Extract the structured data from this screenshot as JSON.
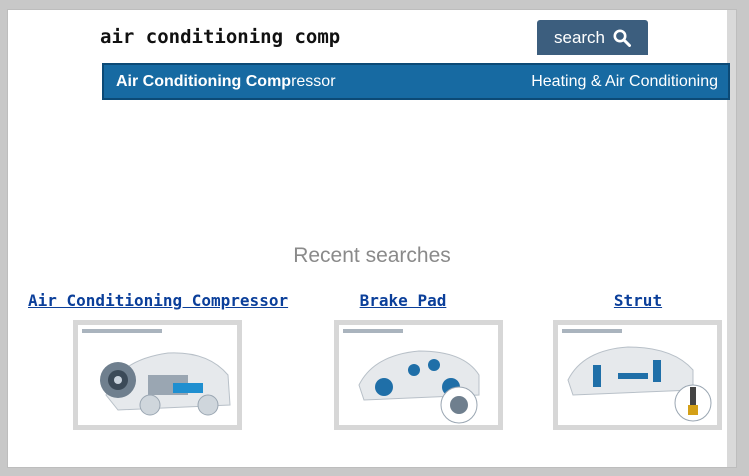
{
  "search": {
    "query": "air conditioning comp",
    "button_label": "search",
    "suggestion": {
      "match": "Air Conditioning Comp",
      "rest": "ressor",
      "category": "Heating & Air Conditioning"
    }
  },
  "recent": {
    "title": "Recent searches",
    "items": [
      {
        "label": "Air Conditioning Compressor",
        "image": "ac-compressor-diagram"
      },
      {
        "label": "Brake Pad",
        "image": "brake-pad-diagram"
      },
      {
        "label": "Strut",
        "image": "strut-diagram"
      }
    ]
  },
  "colors": {
    "suggestion_bg": "#176aa2",
    "button_bg": "#3c5e7e",
    "link": "#0b3f9a"
  }
}
